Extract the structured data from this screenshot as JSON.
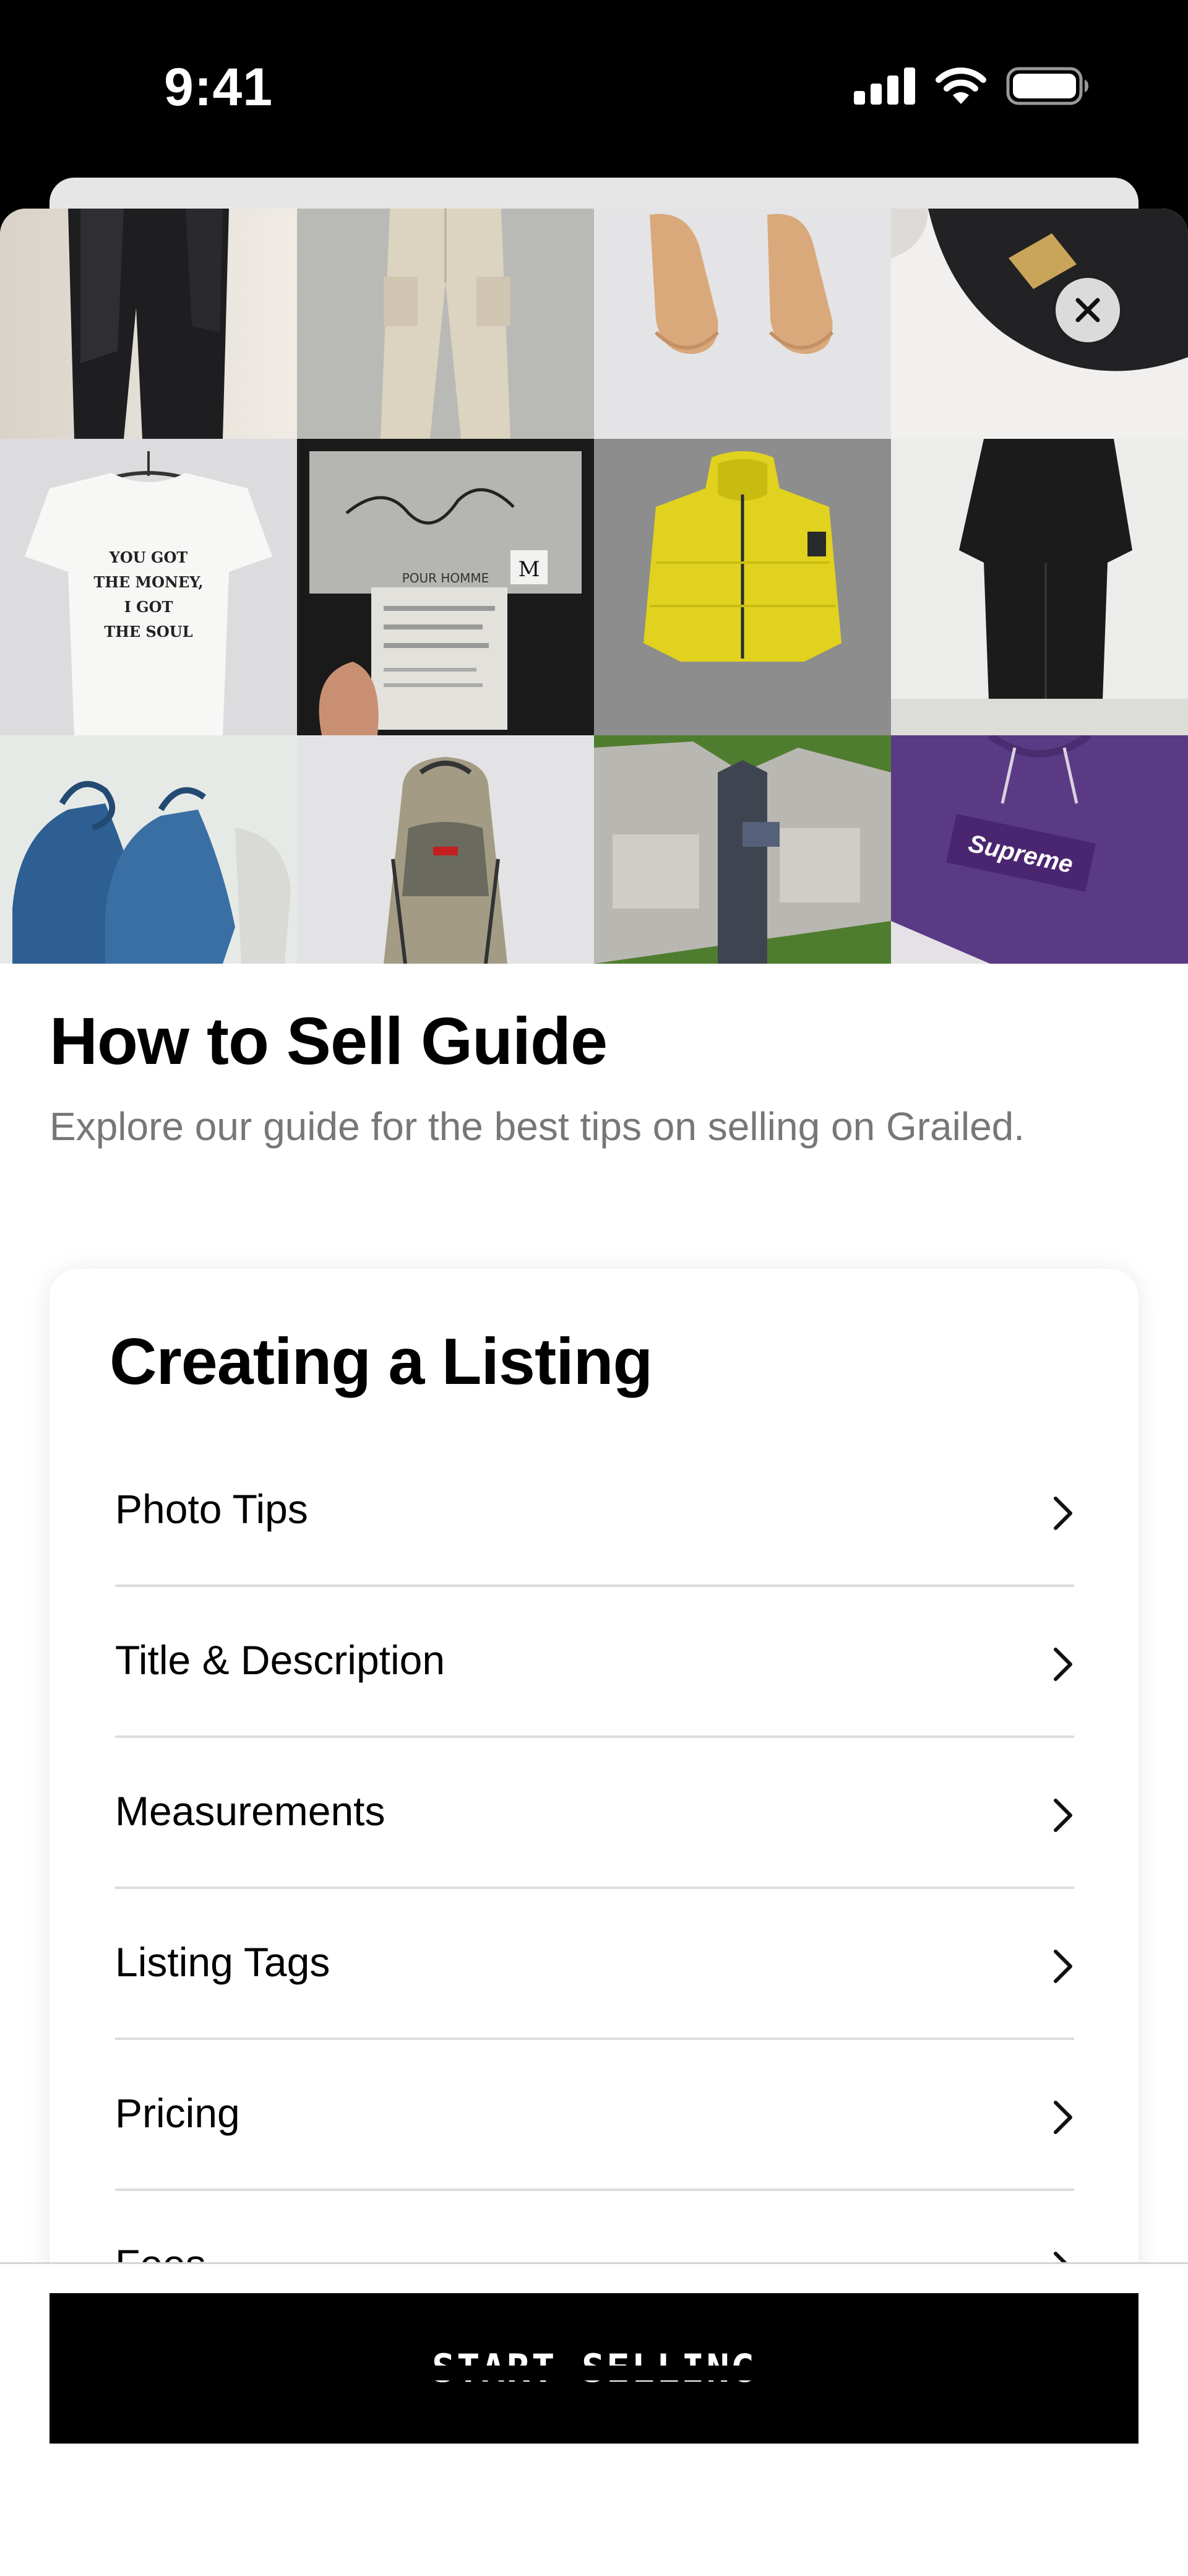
{
  "status_bar": {
    "time": "9:41",
    "icons": [
      "cellular-signal-icon",
      "wifi-icon",
      "battery-icon"
    ]
  },
  "photo_grid": {
    "tiles": [
      {
        "name": "black-coat-and-trousers-photo"
      },
      {
        "name": "cream-cargo-pants-photo"
      },
      {
        "name": "tan-sneakers-photo"
      },
      {
        "name": "black-bag-photo"
      },
      {
        "name": "graphic-tshirt-photo",
        "text": [
          "YOU GOT",
          "THE MONEY,",
          "I GOT",
          "THE SOUL"
        ]
      },
      {
        "name": "clothing-label-photo",
        "text": [
          "POUR HOMME",
          "M"
        ]
      },
      {
        "name": "yellow-puffer-jacket-photo"
      },
      {
        "name": "black-outfit-photo"
      },
      {
        "name": "blue-moccasin-boots-photo"
      },
      {
        "name": "backpack-photo"
      },
      {
        "name": "utility-vest-jacket-photo"
      },
      {
        "name": "purple-hoodie-photo",
        "text": [
          "Supreme"
        ]
      }
    ],
    "close_icon": "close-icon"
  },
  "guide": {
    "title": "How to Sell Guide",
    "subtitle": "Explore our guide for the best tips on selling on Grailed."
  },
  "card": {
    "title": "Creating a Listing",
    "items": [
      {
        "label": "Photo Tips"
      },
      {
        "label": "Title & Description"
      },
      {
        "label": "Measurements"
      },
      {
        "label": "Listing Tags"
      },
      {
        "label": "Pricing"
      },
      {
        "label": "Fees"
      }
    ]
  },
  "footer": {
    "button_label": "START SELLING"
  },
  "colors": {
    "primary": "#000000",
    "background": "#ffffff",
    "subtitle": "#777777",
    "divider": "#dcdcdc"
  }
}
